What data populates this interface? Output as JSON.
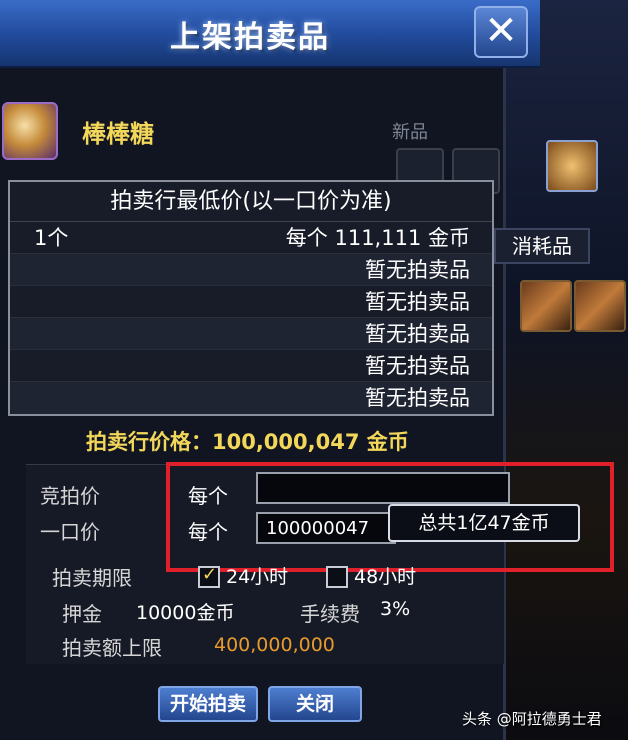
{
  "window": {
    "title": "上架拍卖品",
    "close_glyph": "✕"
  },
  "item": {
    "name": "棒棒糖",
    "new_label": "新品",
    "icon": "lollipop-icon"
  },
  "min_price": {
    "header": "拍卖行最低价(以一口价为准)",
    "rows": [
      {
        "qty": "1个",
        "price": "每个 111,111 金币"
      },
      {
        "qty": "",
        "price": "暂无拍卖品"
      },
      {
        "qty": "",
        "price": "暂无拍卖品"
      },
      {
        "qty": "",
        "price": "暂无拍卖品"
      },
      {
        "qty": "",
        "price": "暂无拍卖品"
      },
      {
        "qty": "",
        "price": "暂无拍卖品"
      }
    ]
  },
  "auction_price": "拍卖行价格：100,000,047 金币",
  "form": {
    "bid_label": "竞拍价",
    "bid_per": "每个",
    "bid_value": "",
    "buyout_label": "一口价",
    "buyout_per": "每个",
    "buyout_value": "100000047",
    "tooltip": "总共1亿47金币",
    "period_label": "拍卖期限",
    "period_24": "24小时",
    "period_48": "48小时",
    "period_selected": "24小时",
    "deposit_label": "押金",
    "deposit_value": "10000金币",
    "fee_label": "手续费",
    "fee_value": "3%",
    "limit_label": "拍卖额上限",
    "limit_value": "400,000,000"
  },
  "buttons": {
    "start": "开始拍卖",
    "close": "关闭"
  },
  "side": {
    "consumable_tab": "消耗品"
  },
  "credit": "头条 @阿拉德勇士君",
  "colors": {
    "accent_gold": "#f3d75a",
    "title_blue": "#2a58b0",
    "highlight_red": "#e0202a",
    "limit_orange": "#e89a2c"
  }
}
